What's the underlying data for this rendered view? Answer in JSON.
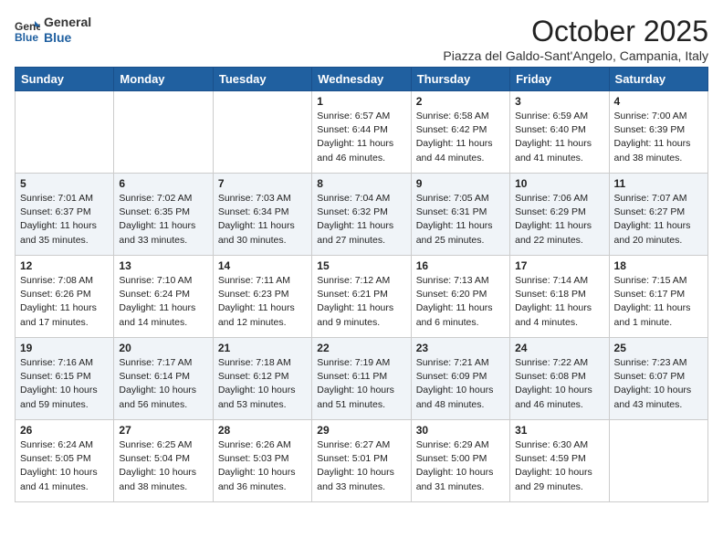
{
  "header": {
    "logo_line1": "General",
    "logo_line2": "Blue",
    "month_title": "October 2025",
    "location": "Piazza del Galdo-Sant'Angelo, Campania, Italy"
  },
  "weekdays": [
    "Sunday",
    "Monday",
    "Tuesday",
    "Wednesday",
    "Thursday",
    "Friday",
    "Saturday"
  ],
  "weeks": [
    [
      {
        "day": "",
        "info": ""
      },
      {
        "day": "",
        "info": ""
      },
      {
        "day": "",
        "info": ""
      },
      {
        "day": "1",
        "info": "Sunrise: 6:57 AM\nSunset: 6:44 PM\nDaylight: 11 hours\nand 46 minutes."
      },
      {
        "day": "2",
        "info": "Sunrise: 6:58 AM\nSunset: 6:42 PM\nDaylight: 11 hours\nand 44 minutes."
      },
      {
        "day": "3",
        "info": "Sunrise: 6:59 AM\nSunset: 6:40 PM\nDaylight: 11 hours\nand 41 minutes."
      },
      {
        "day": "4",
        "info": "Sunrise: 7:00 AM\nSunset: 6:39 PM\nDaylight: 11 hours\nand 38 minutes."
      }
    ],
    [
      {
        "day": "5",
        "info": "Sunrise: 7:01 AM\nSunset: 6:37 PM\nDaylight: 11 hours\nand 35 minutes."
      },
      {
        "day": "6",
        "info": "Sunrise: 7:02 AM\nSunset: 6:35 PM\nDaylight: 11 hours\nand 33 minutes."
      },
      {
        "day": "7",
        "info": "Sunrise: 7:03 AM\nSunset: 6:34 PM\nDaylight: 11 hours\nand 30 minutes."
      },
      {
        "day": "8",
        "info": "Sunrise: 7:04 AM\nSunset: 6:32 PM\nDaylight: 11 hours\nand 27 minutes."
      },
      {
        "day": "9",
        "info": "Sunrise: 7:05 AM\nSunset: 6:31 PM\nDaylight: 11 hours\nand 25 minutes."
      },
      {
        "day": "10",
        "info": "Sunrise: 7:06 AM\nSunset: 6:29 PM\nDaylight: 11 hours\nand 22 minutes."
      },
      {
        "day": "11",
        "info": "Sunrise: 7:07 AM\nSunset: 6:27 PM\nDaylight: 11 hours\nand 20 minutes."
      }
    ],
    [
      {
        "day": "12",
        "info": "Sunrise: 7:08 AM\nSunset: 6:26 PM\nDaylight: 11 hours\nand 17 minutes."
      },
      {
        "day": "13",
        "info": "Sunrise: 7:10 AM\nSunset: 6:24 PM\nDaylight: 11 hours\nand 14 minutes."
      },
      {
        "day": "14",
        "info": "Sunrise: 7:11 AM\nSunset: 6:23 PM\nDaylight: 11 hours\nand 12 minutes."
      },
      {
        "day": "15",
        "info": "Sunrise: 7:12 AM\nSunset: 6:21 PM\nDaylight: 11 hours\nand 9 minutes."
      },
      {
        "day": "16",
        "info": "Sunrise: 7:13 AM\nSunset: 6:20 PM\nDaylight: 11 hours\nand 6 minutes."
      },
      {
        "day": "17",
        "info": "Sunrise: 7:14 AM\nSunset: 6:18 PM\nDaylight: 11 hours\nand 4 minutes."
      },
      {
        "day": "18",
        "info": "Sunrise: 7:15 AM\nSunset: 6:17 PM\nDaylight: 11 hours\nand 1 minute."
      }
    ],
    [
      {
        "day": "19",
        "info": "Sunrise: 7:16 AM\nSunset: 6:15 PM\nDaylight: 10 hours\nand 59 minutes."
      },
      {
        "day": "20",
        "info": "Sunrise: 7:17 AM\nSunset: 6:14 PM\nDaylight: 10 hours\nand 56 minutes."
      },
      {
        "day": "21",
        "info": "Sunrise: 7:18 AM\nSunset: 6:12 PM\nDaylight: 10 hours\nand 53 minutes."
      },
      {
        "day": "22",
        "info": "Sunrise: 7:19 AM\nSunset: 6:11 PM\nDaylight: 10 hours\nand 51 minutes."
      },
      {
        "day": "23",
        "info": "Sunrise: 7:21 AM\nSunset: 6:09 PM\nDaylight: 10 hours\nand 48 minutes."
      },
      {
        "day": "24",
        "info": "Sunrise: 7:22 AM\nSunset: 6:08 PM\nDaylight: 10 hours\nand 46 minutes."
      },
      {
        "day": "25",
        "info": "Sunrise: 7:23 AM\nSunset: 6:07 PM\nDaylight: 10 hours\nand 43 minutes."
      }
    ],
    [
      {
        "day": "26",
        "info": "Sunrise: 6:24 AM\nSunset: 5:05 PM\nDaylight: 10 hours\nand 41 minutes."
      },
      {
        "day": "27",
        "info": "Sunrise: 6:25 AM\nSunset: 5:04 PM\nDaylight: 10 hours\nand 38 minutes."
      },
      {
        "day": "28",
        "info": "Sunrise: 6:26 AM\nSunset: 5:03 PM\nDaylight: 10 hours\nand 36 minutes."
      },
      {
        "day": "29",
        "info": "Sunrise: 6:27 AM\nSunset: 5:01 PM\nDaylight: 10 hours\nand 33 minutes."
      },
      {
        "day": "30",
        "info": "Sunrise: 6:29 AM\nSunset: 5:00 PM\nDaylight: 10 hours\nand 31 minutes."
      },
      {
        "day": "31",
        "info": "Sunrise: 6:30 AM\nSunset: 4:59 PM\nDaylight: 10 hours\nand 29 minutes."
      },
      {
        "day": "",
        "info": ""
      }
    ]
  ]
}
